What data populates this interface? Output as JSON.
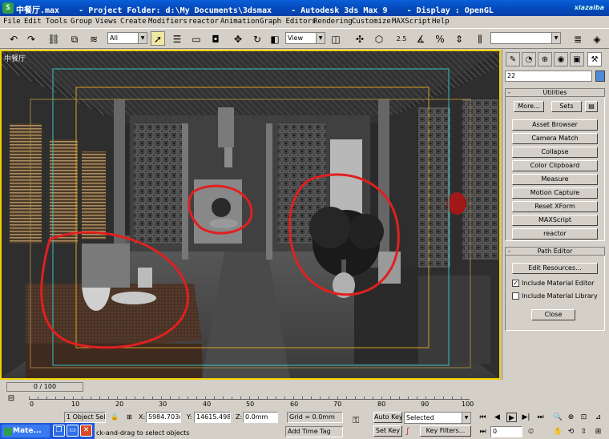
{
  "window": {
    "title": "中餐厅.max    - Project Folder: d:\\My Documents\\3dsmax    - Autodesk 3ds Max 9    - Display : OpenGL",
    "watermark": "xiazaiba"
  },
  "menu": [
    "File",
    "Edit",
    "Tools",
    "Group",
    "Views",
    "Create",
    "Modifiers",
    "reactor",
    "Animation",
    "Graph Editors",
    "Rendering",
    "Customize",
    "MAXScript",
    "Help"
  ],
  "toolbar": {
    "selection_filter": "All",
    "reference_coord": "View",
    "snap_label": "2.5",
    "named_selection": "",
    "icons": [
      "undo-icon",
      "redo-icon",
      "select-link-icon",
      "unlink-icon",
      "bind-space-warp-icon",
      "select-object-icon",
      "select-by-name-icon",
      "rect-region-icon",
      "window-crossing-icon",
      "move-icon",
      "rotate-icon",
      "scale-icon",
      "pivot-icon",
      "select-manipulate-icon",
      "snap-icon",
      "angle-snap-icon",
      "percent-snap-icon",
      "spinner-snap-icon",
      "mirror-icon",
      "align-icon"
    ]
  },
  "viewport": {
    "label": "中餐厅"
  },
  "command_panel": {
    "tabs": [
      "create-tab",
      "modify-tab",
      "hierarchy-tab",
      "motion-tab",
      "display-tab",
      "utilities-tab"
    ],
    "name_field": "22",
    "utilities": {
      "title": "Utilities",
      "more": "More...",
      "sets": "Sets",
      "buttons": [
        "Asset Browser",
        "Camera Match",
        "Collapse",
        "Color Clipboard",
        "Measure",
        "Motion Capture",
        "Reset XForm",
        "MAXScript",
        "reactor"
      ]
    },
    "path_editor": {
      "title": "Path Editor",
      "edit_resources": "Edit Resources...",
      "include_material_editor": "Include Material Editor",
      "include_material_editor_checked": true,
      "include_material_library": "Include Material Library",
      "include_material_library_checked": false,
      "close": "Close"
    }
  },
  "time_slider": {
    "label": "0 / 100",
    "current": 0,
    "max": 100
  },
  "track": {
    "ticks": [
      "0",
      "10",
      "20",
      "30",
      "40",
      "50",
      "60",
      "70",
      "80",
      "90",
      "100"
    ]
  },
  "status": {
    "selection": "1 Object Sele",
    "x_label": "X:",
    "x_value": "5984.703m",
    "y_label": "Y:",
    "y_value": "14615.498",
    "z_label": "Z:",
    "z_value": "0.0mm",
    "grid": "Grid = 0.0mm",
    "prompt": "ck-and-drag to select objects",
    "add_time_tag": "Add Time Tag",
    "auto_key": "Auto Key",
    "set_key": "Set Key",
    "key_mode": "Selected",
    "key_filters": "Key Filters...",
    "frame": "0"
  },
  "taskbar": {
    "label": "Mate..."
  }
}
